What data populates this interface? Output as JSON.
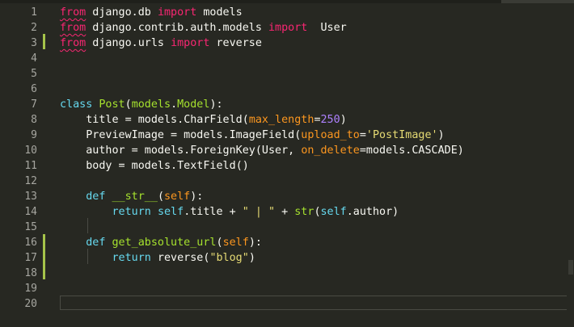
{
  "editor": {
    "line_numbers": [
      "1",
      "2",
      "3",
      "4",
      "5",
      "6",
      "7",
      "8",
      "9",
      "10",
      "11",
      "12",
      "13",
      "14",
      "15",
      "16",
      "17",
      "18",
      "19",
      "20"
    ],
    "lines": [
      [
        {
          "t": "from",
          "c": "kwimp squiggle"
        },
        {
          "t": " django.db ",
          "c": "plain"
        },
        {
          "t": "import",
          "c": "kwimp"
        },
        {
          "t": " models",
          "c": "plain"
        }
      ],
      [
        {
          "t": "from",
          "c": "kwimp squiggle"
        },
        {
          "t": " django.contrib.auth.models ",
          "c": "plain"
        },
        {
          "t": "import",
          "c": "kwimp"
        },
        {
          "t": "  User",
          "c": "plain"
        }
      ],
      [
        {
          "t": "from",
          "c": "kwimp squiggle"
        },
        {
          "t": " django.urls ",
          "c": "plain"
        },
        {
          "t": "import",
          "c": "kwimp"
        },
        {
          "t": " reverse",
          "c": "plain"
        }
      ],
      [],
      [],
      [],
      [
        {
          "t": "class",
          "c": "kw"
        },
        {
          "t": " ",
          "c": "plain"
        },
        {
          "t": "Post",
          "c": "cls"
        },
        {
          "t": "(",
          "c": "plain"
        },
        {
          "t": "models",
          "c": "cls"
        },
        {
          "t": ".",
          "c": "plain"
        },
        {
          "t": "Model",
          "c": "cls"
        },
        {
          "t": "):",
          "c": "plain"
        }
      ],
      [
        {
          "t": "    title = models.",
          "c": "plain"
        },
        {
          "t": "CharField",
          "c": "plain"
        },
        {
          "t": "(",
          "c": "plain"
        },
        {
          "t": "max_length",
          "c": "arg"
        },
        {
          "t": "=",
          "c": "plain"
        },
        {
          "t": "250",
          "c": "num"
        },
        {
          "t": ")",
          "c": "plain"
        }
      ],
      [
        {
          "t": "    PreviewImage = models.",
          "c": "plain"
        },
        {
          "t": "ImageField",
          "c": "plain"
        },
        {
          "t": "(",
          "c": "plain"
        },
        {
          "t": "upload_to",
          "c": "arg"
        },
        {
          "t": "=",
          "c": "plain"
        },
        {
          "t": "'PostImage'",
          "c": "str"
        },
        {
          "t": ")",
          "c": "plain"
        }
      ],
      [
        {
          "t": "    author = models.",
          "c": "plain"
        },
        {
          "t": "ForeignKey",
          "c": "plain"
        },
        {
          "t": "(User, ",
          "c": "plain"
        },
        {
          "t": "on_delete",
          "c": "arg"
        },
        {
          "t": "=models.CASCADE)",
          "c": "plain"
        }
      ],
      [
        {
          "t": "    body = models.",
          "c": "plain"
        },
        {
          "t": "TextField",
          "c": "plain"
        },
        {
          "t": "()",
          "c": "plain"
        }
      ],
      [],
      [
        {
          "t": "    ",
          "c": "plain"
        },
        {
          "t": "def",
          "c": "kw"
        },
        {
          "t": " ",
          "c": "plain"
        },
        {
          "t": "__str__",
          "c": "fn"
        },
        {
          "t": "(",
          "c": "plain"
        },
        {
          "t": "self",
          "c": "arg"
        },
        {
          "t": "):",
          "c": "plain"
        }
      ],
      [
        {
          "t": "        ",
          "c": "plain"
        },
        {
          "t": "return",
          "c": "kw"
        },
        {
          "t": " ",
          "c": "plain"
        },
        {
          "t": "self",
          "c": "self"
        },
        {
          "t": ".title + ",
          "c": "plain"
        },
        {
          "t": "\" | \"",
          "c": "str"
        },
        {
          "t": " + ",
          "c": "plain"
        },
        {
          "t": "str",
          "c": "fn"
        },
        {
          "t": "(",
          "c": "plain"
        },
        {
          "t": "self",
          "c": "self"
        },
        {
          "t": ".author)",
          "c": "plain"
        }
      ],
      [],
      [
        {
          "t": "    ",
          "c": "plain"
        },
        {
          "t": "def",
          "c": "kw"
        },
        {
          "t": " ",
          "c": "plain"
        },
        {
          "t": "get_absolute_url",
          "c": "fn"
        },
        {
          "t": "(",
          "c": "plain"
        },
        {
          "t": "self",
          "c": "arg"
        },
        {
          "t": "):",
          "c": "plain"
        }
      ],
      [
        {
          "t": "        ",
          "c": "plain"
        },
        {
          "t": "return",
          "c": "kw"
        },
        {
          "t": " reverse(",
          "c": "plain"
        },
        {
          "t": "\"blog\"",
          "c": "str"
        },
        {
          "t": ")",
          "c": "plain"
        }
      ],
      [],
      [],
      []
    ]
  }
}
